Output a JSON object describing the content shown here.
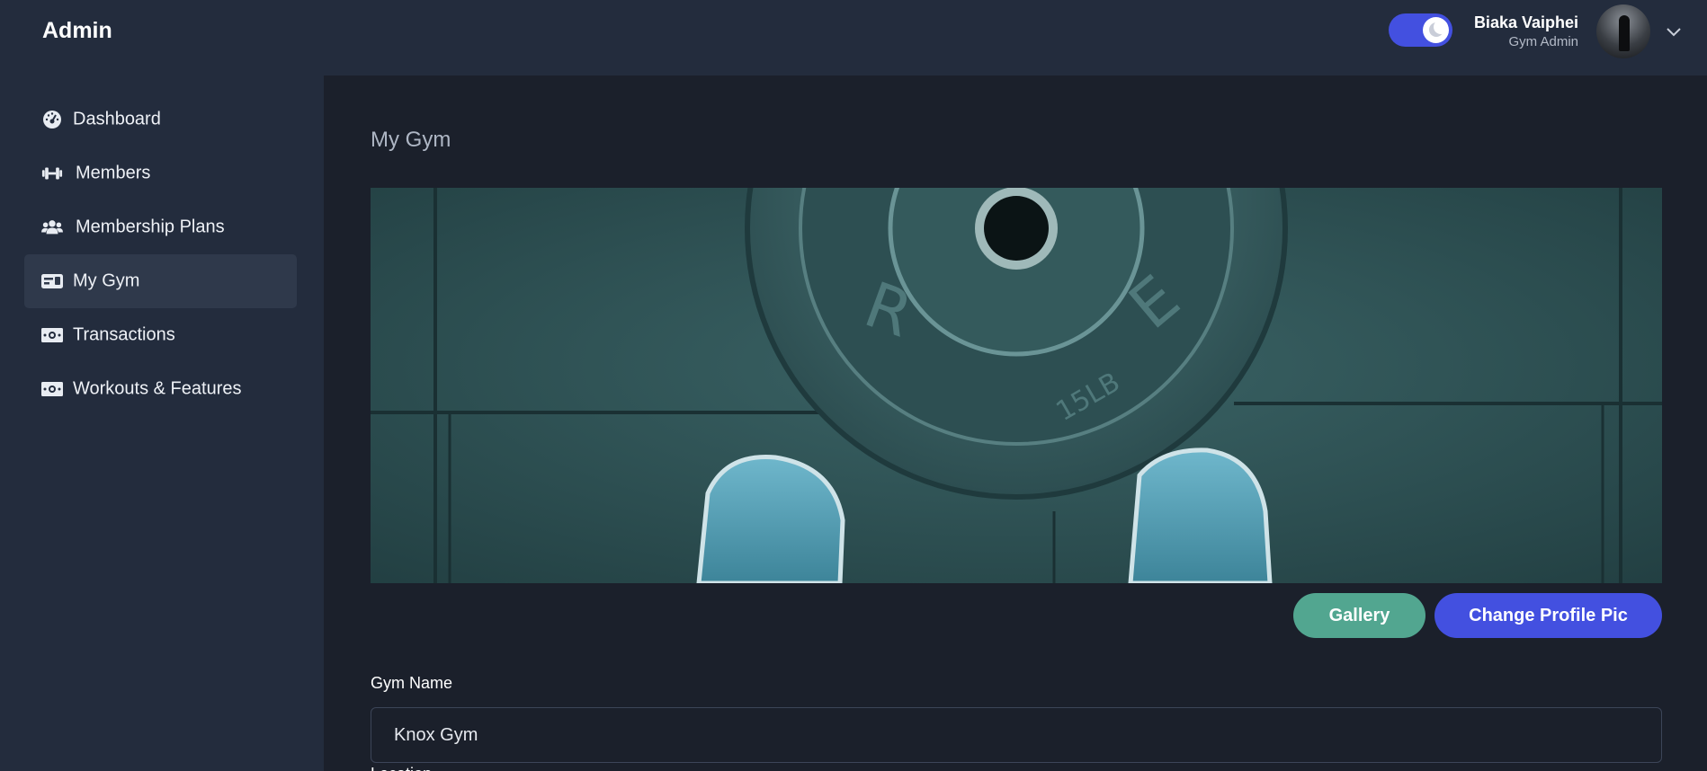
{
  "header": {
    "brand": "Admin",
    "theme_toggle": {
      "state": "dark",
      "icon": "moon-icon"
    },
    "user": {
      "name": "Biaka Vaiphei",
      "role": "Gym Admin",
      "menu_icon": "chevron-down-icon"
    }
  },
  "sidebar": {
    "items": [
      {
        "label": "Dashboard",
        "icon": "gauge-icon",
        "active": false
      },
      {
        "label": "Members",
        "icon": "dumbbell-icon",
        "active": false
      },
      {
        "label": "Membership Plans",
        "icon": "users-icon",
        "active": false
      },
      {
        "label": "My Gym",
        "icon": "id-card-icon",
        "active": true
      },
      {
        "label": "Transactions",
        "icon": "money-bill-icon",
        "active": false
      },
      {
        "label": "Workouts & Features",
        "icon": "money-bill-icon",
        "active": false
      }
    ]
  },
  "main": {
    "title": "My Gym",
    "banner_image": "weight plate on gym floor with blue sneakers",
    "buttons": {
      "gallery": "Gallery",
      "change_pic": "Change Profile Pic"
    },
    "form": {
      "gym_name_label": "Gym Name",
      "gym_name_value": "Knox Gym",
      "next_label": "Location"
    }
  },
  "colors": {
    "accent": "#4350e0",
    "gallery_button": "#52a690",
    "sidebar_bg": "#232c3d",
    "content_bg": "#1b202b"
  }
}
